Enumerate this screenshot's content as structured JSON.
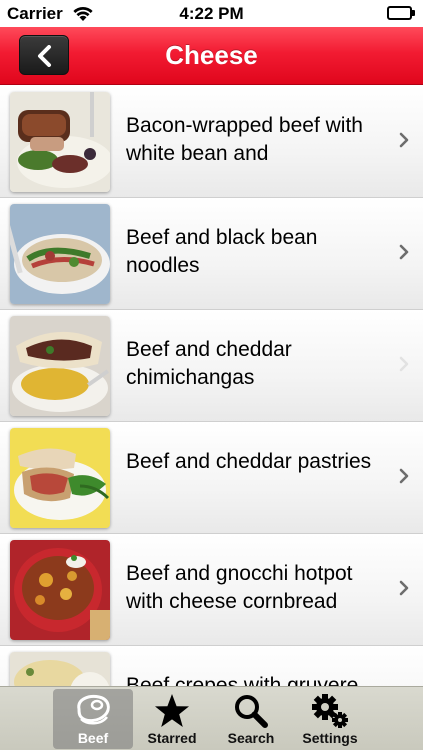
{
  "status_bar": {
    "carrier": "Carrier",
    "time": "4:22 PM"
  },
  "nav": {
    "title": "Cheese",
    "back_icon": "chevron-left-icon"
  },
  "recipes": [
    {
      "title": "Bacon-wrapped beef with white bean and",
      "image": "bacon-wrapped-beef-photo"
    },
    {
      "title": "Beef and black bean noodles",
      "image": "beef-black-bean-noodles-photo"
    },
    {
      "title": "Beef and cheddar chimichangas",
      "image": "beef-cheddar-chimichangas-photo"
    },
    {
      "title": "Beef and cheddar pastries",
      "image": "beef-cheddar-pastries-photo"
    },
    {
      "title": "Beef and gnocchi hotpot with cheese cornbread",
      "image": "beef-gnocchi-hotpot-photo"
    },
    {
      "title": "Beef crepes with gruyere",
      "image": "beef-crepes-photo"
    }
  ],
  "tabs": [
    {
      "label": "Beef",
      "icon": "steak-icon",
      "selected": true
    },
    {
      "label": "Starred",
      "icon": "star-icon",
      "selected": false
    },
    {
      "label": "Search",
      "icon": "search-icon",
      "selected": false
    },
    {
      "label": "Settings",
      "icon": "gears-icon",
      "selected": false
    }
  ],
  "colors": {
    "nav_red": "#e8102a",
    "back_button": "#222222",
    "tab_bar": "#cfcfc4"
  }
}
